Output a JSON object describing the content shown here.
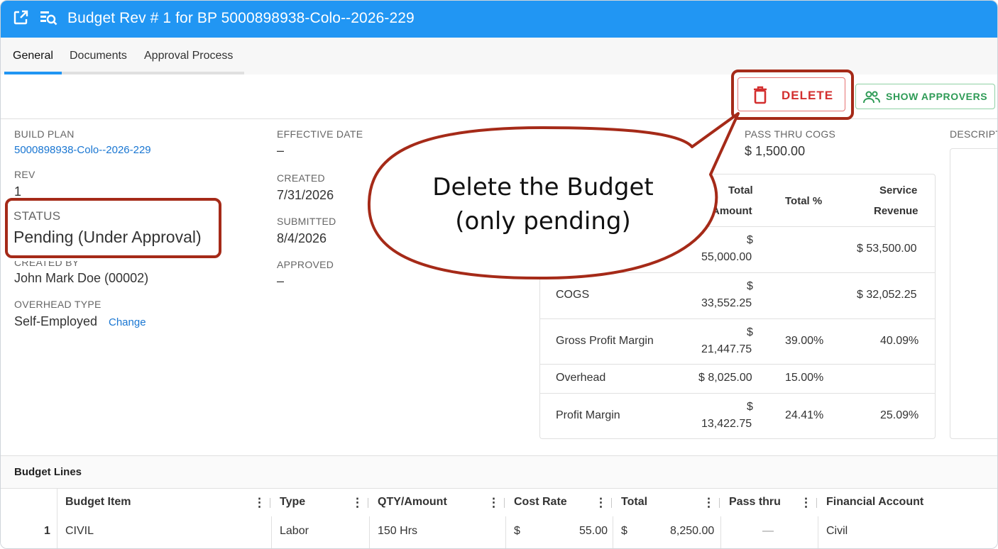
{
  "header": {
    "title": "Budget Rev # 1 for BP 5000898938-Colo--2026-229"
  },
  "tabs": [
    {
      "label": "General"
    },
    {
      "label": "Documents"
    },
    {
      "label": "Approval Process"
    }
  ],
  "actions": {
    "delete_label": "DELETE",
    "show_approvers_label": "SHOW APPROVERS"
  },
  "fields": {
    "build_plan_label": "BUILD PLAN",
    "build_plan_value": "5000898938-Colo--2026-229",
    "rev_label": "REV",
    "rev_value": "1",
    "status_label": "STATUS",
    "status_value": "Pending (Under Approval)",
    "created_by_label": "CREATED BY",
    "created_by_value": "John Mark Doe (00002)",
    "overhead_type_label": "OVERHEAD TYPE",
    "overhead_type_value": "Self-Employed",
    "change_link": "Change",
    "effective_date_label": "EFFECTIVE DATE",
    "effective_date_value": "–",
    "created_label": "CREATED",
    "created_value": "7/31/2026",
    "submitted_label": "SUBMITTED",
    "submitted_value": "8/4/2026",
    "approved_label": "APPROVED",
    "approved_value": "–",
    "pass_thru_cogs_label": "PASS THRU COGS",
    "pass_thru_cogs_value": "$ 1,500.00",
    "description_label": "DESCRIPT"
  },
  "summary": {
    "headers": {
      "total_line1": "Total",
      "total_line2": "Amount",
      "total_pct": "Total %",
      "svc_line1": "Service",
      "svc_line2": "Revenue"
    },
    "rows": [
      {
        "label": "",
        "total_l1": "$",
        "total_l2": "55,000.00",
        "pct": "",
        "svc": "$ 53,500.00"
      },
      {
        "label": "COGS",
        "total_l1": "$",
        "total_l2": "33,552.25",
        "pct": "",
        "svc": "$ 32,052.25"
      },
      {
        "label": "Gross Profit Margin",
        "total_l1": "$",
        "total_l2": "21,447.75",
        "pct": "39.00%",
        "svc": "40.09%"
      },
      {
        "label": "Overhead",
        "total_l1": "",
        "total_l2": "$ 8,025.00",
        "pct": "15.00%",
        "svc": ""
      },
      {
        "label": "Profit Margin",
        "total_l1": "$",
        "total_l2": "13,422.75",
        "pct": "24.41%",
        "svc": "25.09%"
      }
    ]
  },
  "budget_lines": {
    "title": "Budget Lines",
    "columns": [
      "Budget Item",
      "Type",
      "QTY/Amount",
      "Cost Rate",
      "Total",
      "Pass thru",
      "Financial Account"
    ],
    "rows": [
      {
        "num": "1",
        "item": "CIVIL",
        "type": "Labor",
        "qty": "150 Hrs",
        "rate_sym": "$",
        "rate": "55.00",
        "total_sym": "$",
        "total": "8,250.00",
        "pass_thru": "—",
        "account": "Civil"
      }
    ]
  },
  "callout": {
    "line1": "Delete the Budget",
    "line2": "(only pending)"
  },
  "colors": {
    "header_blue": "#2196f3",
    "delete_red": "#d32f2f",
    "approvers_green": "#2e9b56",
    "highlight": "#a52a18"
  }
}
